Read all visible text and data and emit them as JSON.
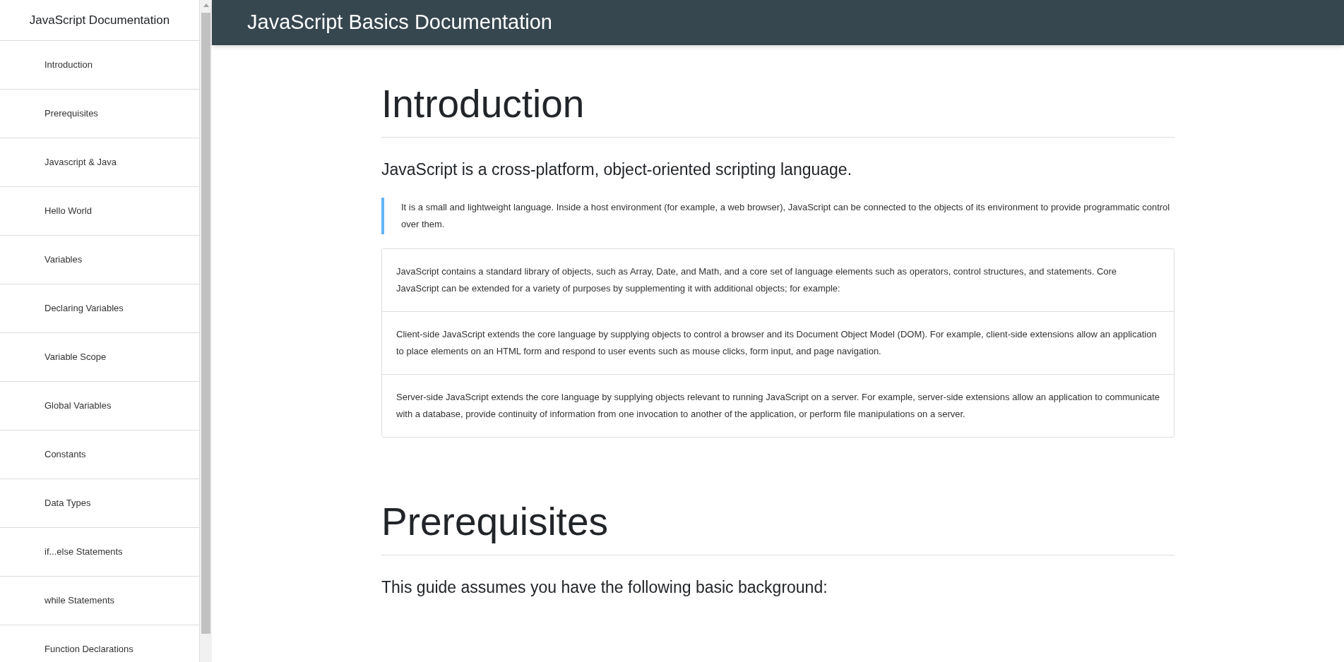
{
  "sidebar": {
    "title": "JavaScript Documentation",
    "items": [
      {
        "label": "Introduction"
      },
      {
        "label": "Prerequisites"
      },
      {
        "label": "Javascript & Java"
      },
      {
        "label": "Hello World"
      },
      {
        "label": "Variables"
      },
      {
        "label": "Declaring Variables"
      },
      {
        "label": "Variable Scope"
      },
      {
        "label": "Global Variables"
      },
      {
        "label": "Constants"
      },
      {
        "label": "Data Types"
      },
      {
        "label": "if...else Statements"
      },
      {
        "label": "while Statements"
      },
      {
        "label": "Function Declarations"
      }
    ]
  },
  "header": {
    "title": "JavaScript Basics Documentation"
  },
  "sections": [
    {
      "heading": "Introduction",
      "lead": "JavaScript is a cross-platform, object-oriented scripting language.",
      "quote": "It is a small and lightweight language. Inside a host environment (for example, a web browser), JavaScript can be connected to the objects of its environment to provide programmatic control over them.",
      "list": [
        "JavaScript contains a standard library of objects, such as Array, Date, and Math, and a core set of language elements such as operators, control structures, and statements. Core JavaScript can be extended for a variety of purposes by supplementing it with additional objects; for example:",
        "Client-side JavaScript extends the core language by supplying objects to control a browser and its Document Object Model (DOM). For example, client-side extensions allow an application to place elements on an HTML form and respond to user events such as mouse clicks, form input, and page navigation.",
        "Server-side JavaScript extends the core language by supplying objects relevant to running JavaScript on a server. For example, server-side extensions allow an application to communicate with a database, provide continuity of information from one invocation to another of the application, or perform file manipulations on a server."
      ]
    },
    {
      "heading": "Prerequisites",
      "lead": "This guide assumes you have the following basic background:"
    }
  ]
}
